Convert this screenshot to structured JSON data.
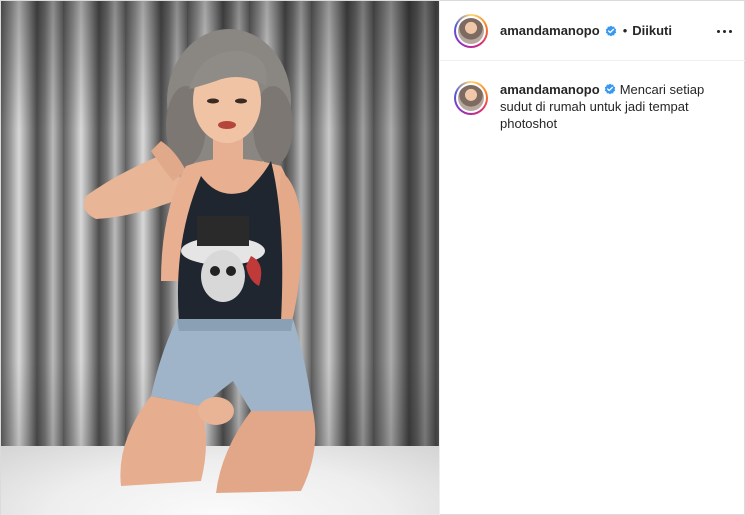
{
  "post": {
    "author": {
      "username": "amandamanopo",
      "verified": true,
      "follow_status": "Diikuti",
      "separator": "•"
    },
    "caption": {
      "username": "amandamanopo",
      "text": "Mencari setiap sudut di rumah untuk jadi tempat photoshot"
    },
    "icons": {
      "verified": "verified-badge-icon",
      "more": "more-options-icon"
    },
    "colors": {
      "verified_blue": "#3897f0",
      "text": "#262626",
      "border": "#dbdbdb"
    }
  }
}
